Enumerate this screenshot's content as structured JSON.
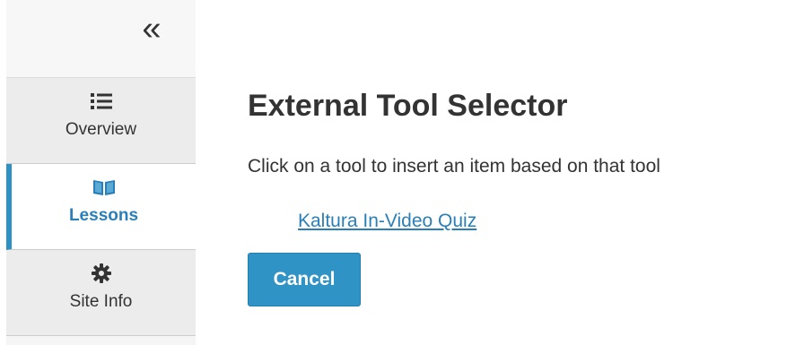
{
  "sidebar": {
    "collapse_glyph": "«",
    "items": [
      {
        "label": "Overview",
        "icon": "list-icon",
        "active": false
      },
      {
        "label": "Lessons",
        "icon": "book-icon",
        "active": true
      },
      {
        "label": "Site Info",
        "icon": "gear-icon",
        "active": false
      }
    ]
  },
  "main": {
    "title": "External Tool Selector",
    "instructions": "Click on a tool to insert an item based on that tool",
    "tool_link": "Kaltura In-Video Quiz",
    "cancel_label": "Cancel"
  },
  "colors": {
    "accent": "#2c91c5",
    "link": "#2a7fb8",
    "button": "#3093c6"
  }
}
